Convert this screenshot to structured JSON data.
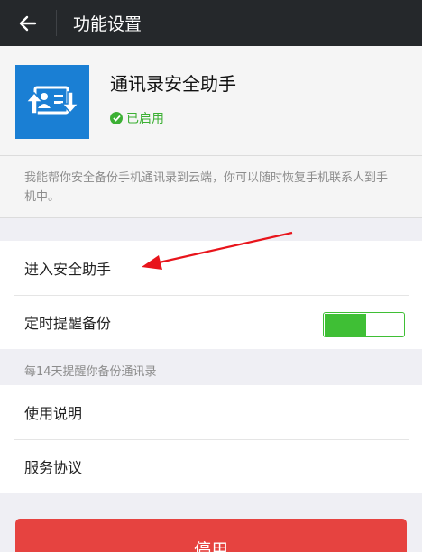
{
  "header": {
    "title": "功能设置",
    "back_icon": "arrow-left-icon"
  },
  "app": {
    "name": "通讯录安全助手",
    "status": "已启用",
    "icon": "contacts-sync-icon",
    "icon_color": "#1a7fd4",
    "status_color": "#3cb034"
  },
  "description": "我能帮你安全备份手机通讯录到云端，你可以随时恢复手机联系人到手机中。",
  "settings": {
    "enter_assistant": "进入安全助手",
    "scheduled_backup": {
      "label": "定时提醒备份",
      "enabled": true,
      "toggle_color": "#3fbf35"
    },
    "hint": "每14天提醒你备份通讯录"
  },
  "info": {
    "usage": "使用说明",
    "agreement": "服务协议"
  },
  "disable_button": {
    "label": "停用",
    "color": "#e64340"
  },
  "annotation": {
    "type": "red-arrow",
    "color": "#e8141b"
  }
}
